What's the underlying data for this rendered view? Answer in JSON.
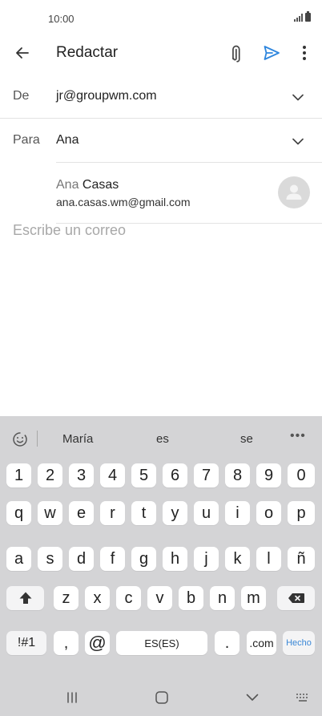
{
  "status_bar": {
    "time": "10:00"
  },
  "app_bar": {
    "title": "Redactar",
    "icons": {
      "back": "arrow-left-icon",
      "attach": "paperclip-icon",
      "send": "send-icon",
      "more": "more-vertical-icon"
    },
    "accent_color": "#2e86de"
  },
  "from": {
    "label": "De",
    "value": "jr@groupwm.com"
  },
  "to": {
    "label": "Para",
    "value": "Ana"
  },
  "suggestion": {
    "name_match": "Ana",
    "name_rest": "Casas",
    "email": "ana.casas.wm@gmail.com"
  },
  "compose": {
    "placeholder": "Escribe un correo"
  },
  "keyboard": {
    "suggestions": [
      "María",
      "es",
      "se"
    ],
    "rows": [
      [
        "1",
        "2",
        "3",
        "4",
        "5",
        "6",
        "7",
        "8",
        "9",
        "0"
      ],
      [
        "q",
        "w",
        "e",
        "r",
        "t",
        "y",
        "u",
        "i",
        "o",
        "p"
      ],
      [
        "a",
        "s",
        "d",
        "f",
        "g",
        "h",
        "j",
        "k",
        "l",
        "ñ"
      ],
      [
        "z",
        "x",
        "c",
        "v",
        "b",
        "n",
        "m"
      ]
    ],
    "bottom": {
      "symbols": "!#1",
      "comma": ",",
      "at": "@",
      "space": "ES(ES)",
      "period": ".",
      "dotcom": ".com",
      "done": "Hecho"
    },
    "done_color": "#3a87d6"
  }
}
